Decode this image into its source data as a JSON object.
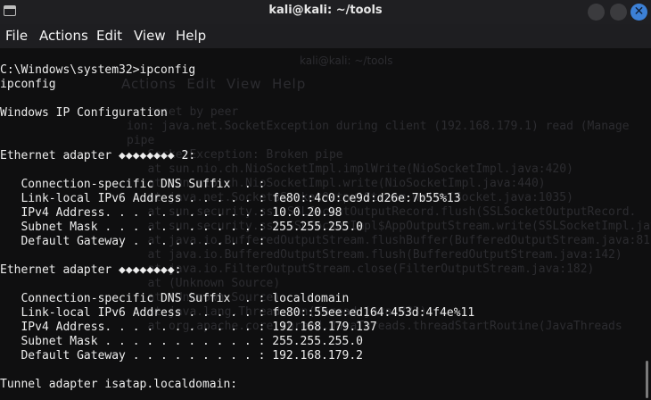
{
  "window": {
    "title": "kali@kali: ~/tools",
    "close_glyph": "✕"
  },
  "menu": {
    "items": [
      "File",
      "Actions",
      "Edit",
      "View",
      "Help"
    ]
  },
  "terminal": {
    "lines": [
      "C:\\Windows\\system32>ipconfig",
      "ipconfig",
      "",
      "Windows IP Configuration",
      "",
      "",
      "Ethernet adapter ◆◆◆◆◆◆◆◆ 2:",
      "",
      "   Connection-specific DNS Suffix  . :",
      "   Link-local IPv6 Address . . . . . : fe80::4c0:ce9d:d26e:7b55%13",
      "   IPv4 Address. . . . . . . . . . . : 10.0.20.98",
      "   Subnet Mask . . . . . . . . . . . : 255.255.255.0",
      "   Default Gateway . . . . . . . . . :",
      "",
      "Ethernet adapter ◆◆◆◆◆◆◆◆:",
      "",
      "   Connection-specific DNS Suffix  . : localdomain",
      "   Link-local IPv6 Address . . . . . : fe80::55ee:ed164:453d:4f4e%11",
      "   IPv4 Address. . . . . . . . . . . : 192.168.179.137",
      "   Subnet Mask . . . . . . . . . . . : 255.255.255.0",
      "   Default Gateway . . . . . . . . . : 192.168.179.2",
      "",
      "Tunnel adapter isatap.localdomain:"
    ]
  },
  "background_window": {
    "title": "kali@kali: ~/tools",
    "menu": "Actions  Edit  View  Help",
    "lines": [
      "   reset by peer",
      "ion: java.net.SocketException during client (192.168.179.1) read (Manage",
      "pipe",
      "   SocketException: Broken pipe",
      "   at sun.nio.ch.NioSocketImpl.implWrite(NioSocketImpl.java:420)",
      "   at sun.nio.ch.NioSocketImpl.write(NioSocketImpl.java:440)",
      "   at java.net.Socket$SocketOutputStream.write(Socket.java:1035)",
      "   at sun.security.ssl.SSLSocketOutputRecord.flush(SSLSocketOutputRecord.",
      "   at sun.security.ssl.SSLSocketImpl$AppOutputStream.write(SSLSocketImpl.jav",
      "   at java.io.BufferedOutputStream.flushBuffer(BufferedOutputStream.java:81",
      "   at java.io.BufferedOutputStream.flush(BufferedOutputStream.java:142)",
      "   at java.io.FilterOutputStream.close(FilterOutputStream.java:182)",
      "",
      "   at (Unknown Source)",
      "   at (Unknown Source)",
      "   at java.lang.Thread.run(Thread.java:833)",
      "   at org.apache.core.thread.JavaThreads.threadStartRoutine(JavaThreads"
    ]
  },
  "colors": {
    "terminal_bg": "#0f0f10",
    "terminal_fg": "#ededed",
    "titlebar_bg": "#1f1f22",
    "close_button": "#3c80d6"
  }
}
